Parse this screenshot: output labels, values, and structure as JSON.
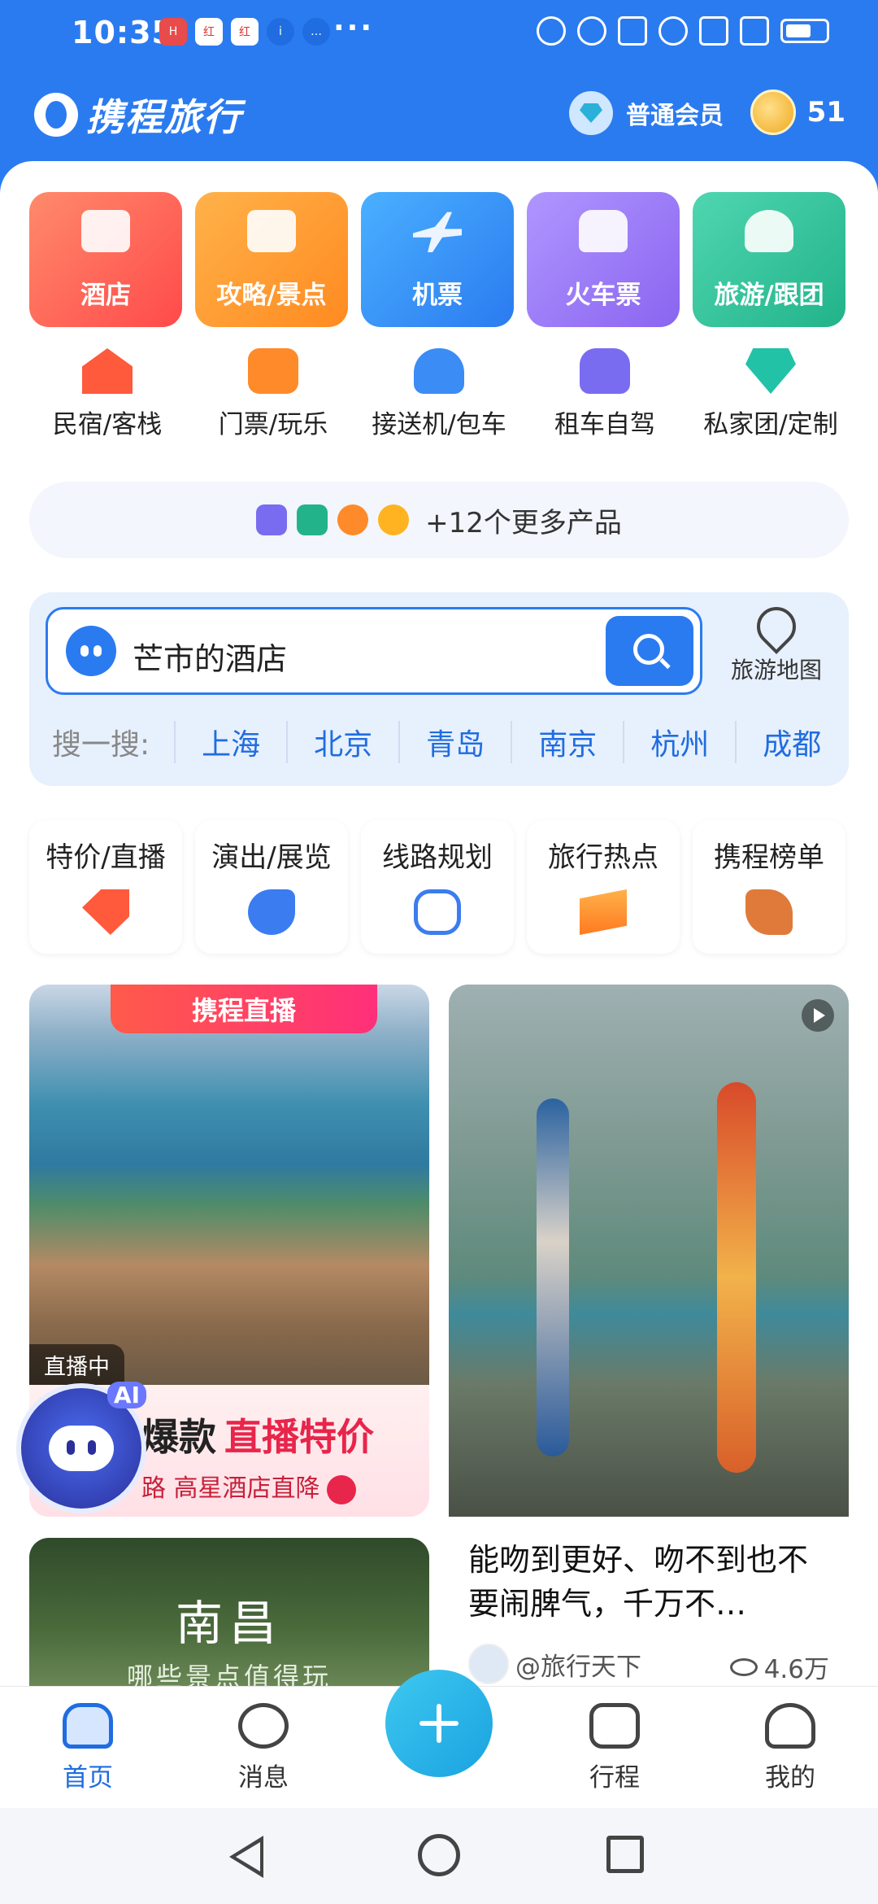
{
  "status_bar": {
    "time": "10:35",
    "mini_apps": [
      "H",
      "红",
      "红",
      "i",
      "…"
    ],
    "dots": "···"
  },
  "header": {
    "brand": "携程旅行",
    "member_label": "普通会员",
    "coins": "51"
  },
  "main_tiles": [
    {
      "label": "酒店",
      "icon": "hotel-icon"
    },
    {
      "label": "攻略/景点",
      "icon": "guidebook-icon"
    },
    {
      "label": "机票",
      "icon": "airplane-icon"
    },
    {
      "label": "火车票",
      "icon": "train-icon"
    },
    {
      "label": "旅游/跟团",
      "icon": "palm-tree-icon"
    }
  ],
  "sub_items": [
    {
      "label": "民宿/客栈",
      "icon": "house-icon"
    },
    {
      "label": "门票/玩乐",
      "icon": "ticket-icon"
    },
    {
      "label": "接送机/包车",
      "icon": "car-transfer-icon"
    },
    {
      "label": "租车自驾",
      "icon": "car-icon"
    },
    {
      "label": "私家团/定制",
      "icon": "diamond-icon"
    }
  ],
  "more_products": {
    "label": "+12个更多产品"
  },
  "search": {
    "text": "芒市的酒店",
    "map_label": "旅游地图",
    "hot_label": "搜一搜:",
    "cities": [
      "上海",
      "北京",
      "青岛",
      "南京",
      "杭州",
      "成都"
    ]
  },
  "features": [
    {
      "label": "特价/直播",
      "icon": "price-tag-icon"
    },
    {
      "label": "演出/展览",
      "icon": "music-note-icon"
    },
    {
      "label": "线路规划",
      "icon": "route-icon"
    },
    {
      "label": "旅行热点",
      "icon": "trending-icon"
    },
    {
      "label": "携程榜单",
      "icon": "ranking-icon"
    }
  ],
  "feed": {
    "live_card": {
      "badge": "携程直播",
      "live_now": "直播中",
      "title_a": "爆款",
      "title_b": "直播特价",
      "subtitle": "路 高星酒店直降"
    },
    "city_card": {
      "city": "南昌",
      "subtitle": "哪些景点值得玩"
    },
    "post_card": {
      "title": "能吻到更好、吻不到也不要闹脾气，千万不…",
      "author": "@旅行天下",
      "views": "4.6万"
    }
  },
  "ai_bot": {
    "badge": "AI"
  },
  "tabbar": {
    "home": "首页",
    "messages": "消息",
    "trips": "行程",
    "mine": "我的"
  },
  "colors": {
    "brand_blue": "#2b7bf0",
    "live_red": "#e8254a",
    "link_blue": "#1f6de0"
  }
}
